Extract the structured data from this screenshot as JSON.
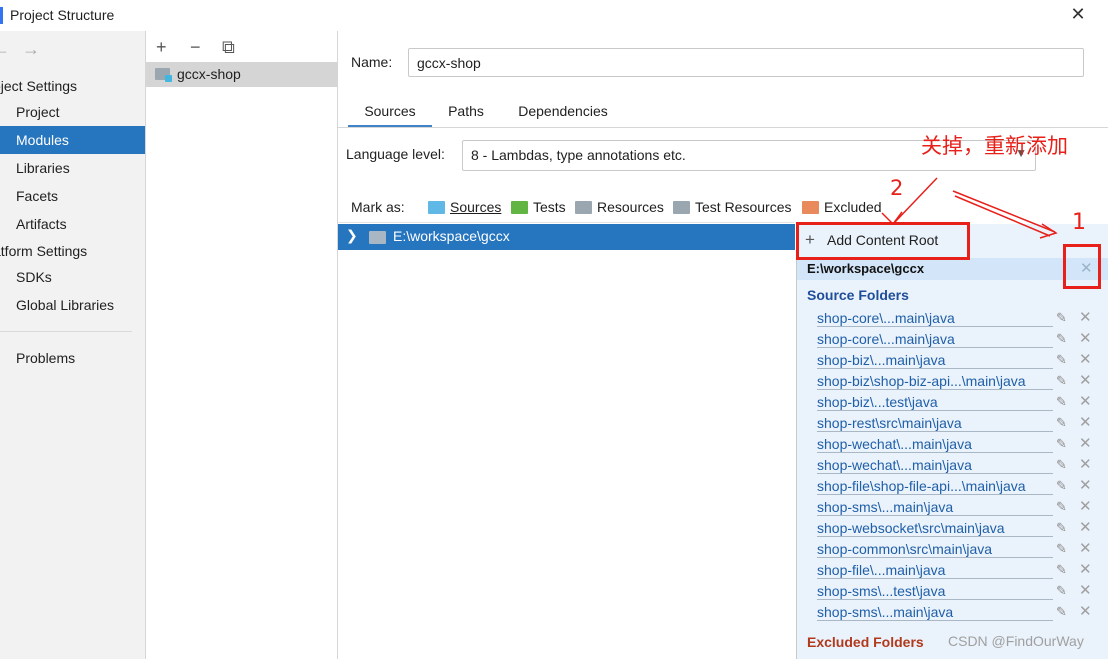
{
  "window": {
    "title": "Project Structure",
    "close_glyph": "✕"
  },
  "nav": {
    "back_glyph": "←",
    "forward_glyph": "→",
    "project_settings_label": "oject Settings",
    "project_settings_items": [
      "Project",
      "Modules",
      "Libraries",
      "Facets",
      "Artifacts"
    ],
    "active_item": "Modules",
    "platform_settings_label": "atform Settings",
    "platform_settings_items": [
      "SDKs",
      "Global Libraries"
    ],
    "problems_label": "Problems"
  },
  "modules": {
    "add_glyph": "+",
    "remove_glyph": "−",
    "copy_glyph": "⧉",
    "items": [
      {
        "name": "gccx-shop",
        "icon": "module-folder-icon"
      }
    ]
  },
  "module": {
    "name_label": "Name:",
    "name_value": "gccx-shop",
    "tabs": [
      "Sources",
      "Paths",
      "Dependencies"
    ],
    "active_tab": "Sources",
    "language_level_label": "Language level:",
    "language_level_value": "8 - Lambdas, type annotations etc.",
    "mark_as_label": "Mark as:",
    "mark_as": [
      {
        "label": "Sources",
        "color": "#5fb8e6"
      },
      {
        "label": "Tests",
        "color": "#62b543"
      },
      {
        "label": "Resources",
        "color": "#9aa7b0"
      },
      {
        "label": "Test Resources",
        "color": "#9aa7b0"
      },
      {
        "label": "Excluded",
        "color": "#e88a5c"
      }
    ],
    "tree_root": {
      "chevron": "›",
      "path": "E:\\workspace\\gccx"
    }
  },
  "content_root": {
    "add_label": "Add Content Root",
    "root_path": "E:\\workspace\\gccx",
    "source_folders_title": "Source Folders",
    "source_folders_color": "#1f4e99",
    "source_folders": [
      "shop-core\\...main\\java",
      "shop-core\\...main\\java",
      "shop-biz\\...main\\java",
      "shop-biz\\shop-biz-api...\\main\\java",
      "shop-biz\\...test\\java",
      "shop-rest\\src\\main\\java",
      "shop-wechat\\...main\\java",
      "shop-wechat\\...main\\java",
      "shop-file\\shop-file-api...\\main\\java",
      "shop-sms\\...main\\java",
      "shop-websocket\\src\\main\\java",
      "shop-common\\src\\main\\java",
      "shop-file\\...main\\java",
      "shop-sms\\...test\\java",
      "shop-sms\\...main\\java"
    ],
    "excluded_folders_title": "Excluded Folders",
    "excluded_folders_color": "#b23a1c"
  },
  "annotations": {
    "note": "关掉，重新添加",
    "label_1": "1",
    "label_2": "2",
    "color": "#e8201a"
  },
  "watermark": "CSDN @FindOurWay"
}
